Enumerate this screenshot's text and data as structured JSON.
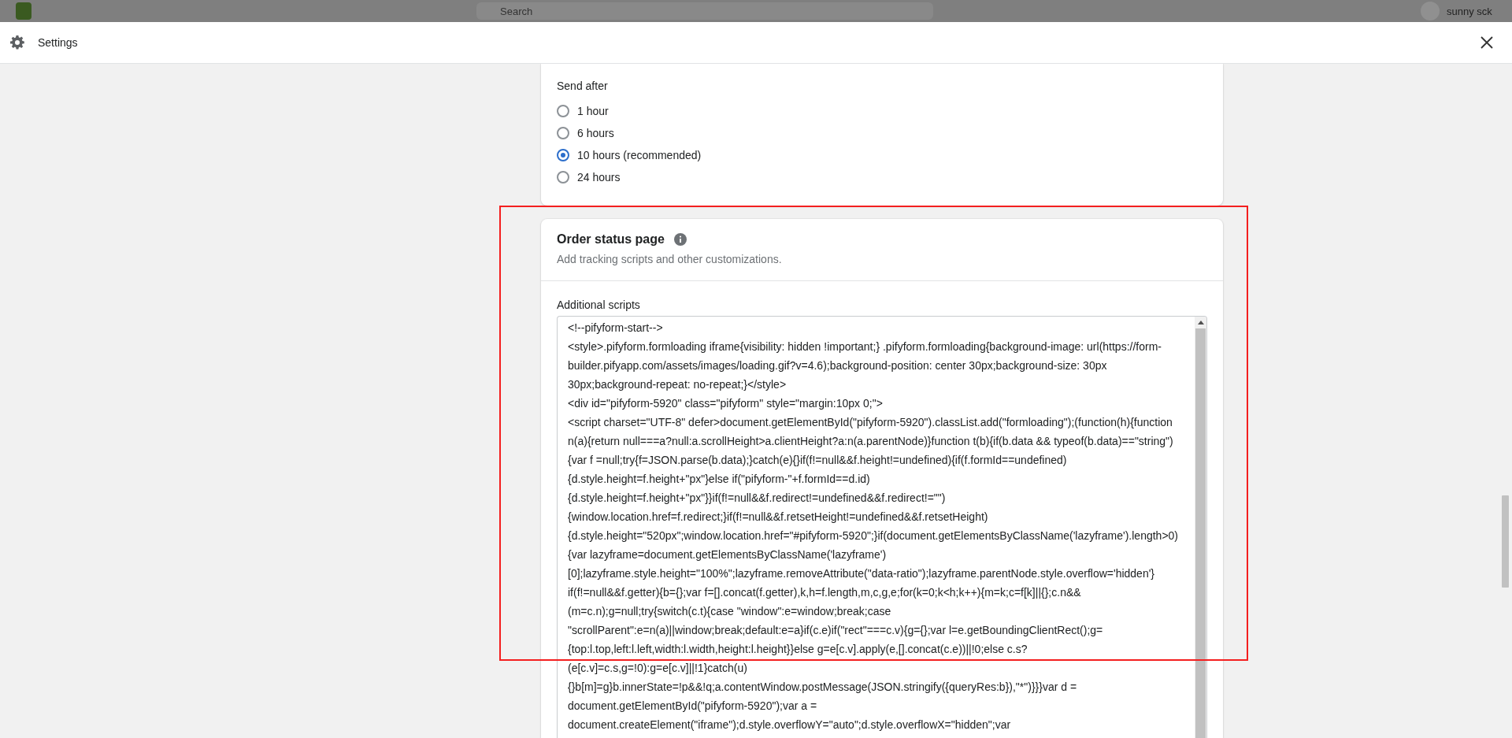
{
  "backdrop": {
    "search": {
      "placeholder": "Search"
    },
    "user": "sunny sck"
  },
  "window": {
    "title": "Settings"
  },
  "send_after": {
    "label": "Send after",
    "options": [
      {
        "label": "1 hour",
        "selected": false
      },
      {
        "label": "6 hours",
        "selected": false
      },
      {
        "label": "10 hours (recommended)",
        "selected": true
      },
      {
        "label": "24 hours",
        "selected": false
      }
    ]
  },
  "order_status_page": {
    "title": "Order status page",
    "subtitle": "Add tracking scripts and other customizations.",
    "scripts_label": "Additional scripts",
    "script_lines": [
      "<!--pifyform-start-->",
      "<style>.pifyform.formloading iframe{visibility: hidden !important;} .pifyform.formloading{background-image: url(https://form-",
      "builder.pifyapp.com/assets/images/loading.gif?v=4.6);background-position: center 30px;background-size: 30px",
      "30px;background-repeat: no-repeat;}</style>",
      "<div id=\"pifyform-5920\" class=\"pifyform\" style=\"margin:10px 0;\">",
      "<script charset=\"UTF-8\" defer>document.getElementById(\"pifyform-5920\").classList.add(\"formloading\");(function(h){function",
      "n(a){return null===a?null:a.scrollHeight>a.clientHeight?a:n(a.parentNode)}function t(b){if(b.data && typeof(b.data)==\"string\")",
      "{var f =null;try{f=JSON.parse(b.data);}catch(e){}if(f!=null&&f.height!=undefined){if(f.formId==undefined)",
      "{d.style.height=f.height+\"px\"}else if(\"pifyform-\"+f.formId==d.id)",
      "{d.style.height=f.height+\"px\"}}if(f!=null&&f.redirect!=undefined&&f.redirect!=\"\")",
      "{window.location.href=f.redirect;}if(f!=null&&f.retsetHeight!=undefined&&f.retsetHeight)",
      "{d.style.height=\"520px\";window.location.href=\"#pifyform-5920\";}if(document.getElementsByClassName('lazyframe').length>0)",
      "{var lazyframe=document.getElementsByClassName('lazyframe')",
      "[0];lazyframe.style.height=\"100%\";lazyframe.removeAttribute(\"data-ratio\");lazyframe.parentNode.style.overflow='hidden'}",
      "if(f!=null&&f.getter){b={};var f=[].concat(f.getter),k,h=f.length,m,c,g,e;for(k=0;k<h;k++){m=k;c=f[k]||{};c.n&&",
      "(m=c.n);g=null;try{switch(c.t){case \"window\":e=window;break;case",
      "\"scrollParent\":e=n(a)||window;break;default:e=a}if(c.e)if(\"rect\"===c.v){g={};var l=e.getBoundingClientRect();g=",
      "{top:l.top,left:l.left,width:l.width,height:l.height}}else g=e[c.v].apply(e,[].concat(c.e))||!0;else c.s?",
      "(e[c.v]=c.s,g=!0):g=e[c.v]||!1}catch(u)",
      "{}b[m]=g}b.innerState=!p&&!q;a.contentWindow.postMessage(JSON.stringify({queryRes:b}),\"*\")}}}var d =",
      "document.getElementById(\"pifyform-5920\");var a =",
      "document.createElement(\"iframe\");d.style.overflowY=\"auto\";d.style.overflowX=\"hidden\";var"
    ]
  }
}
